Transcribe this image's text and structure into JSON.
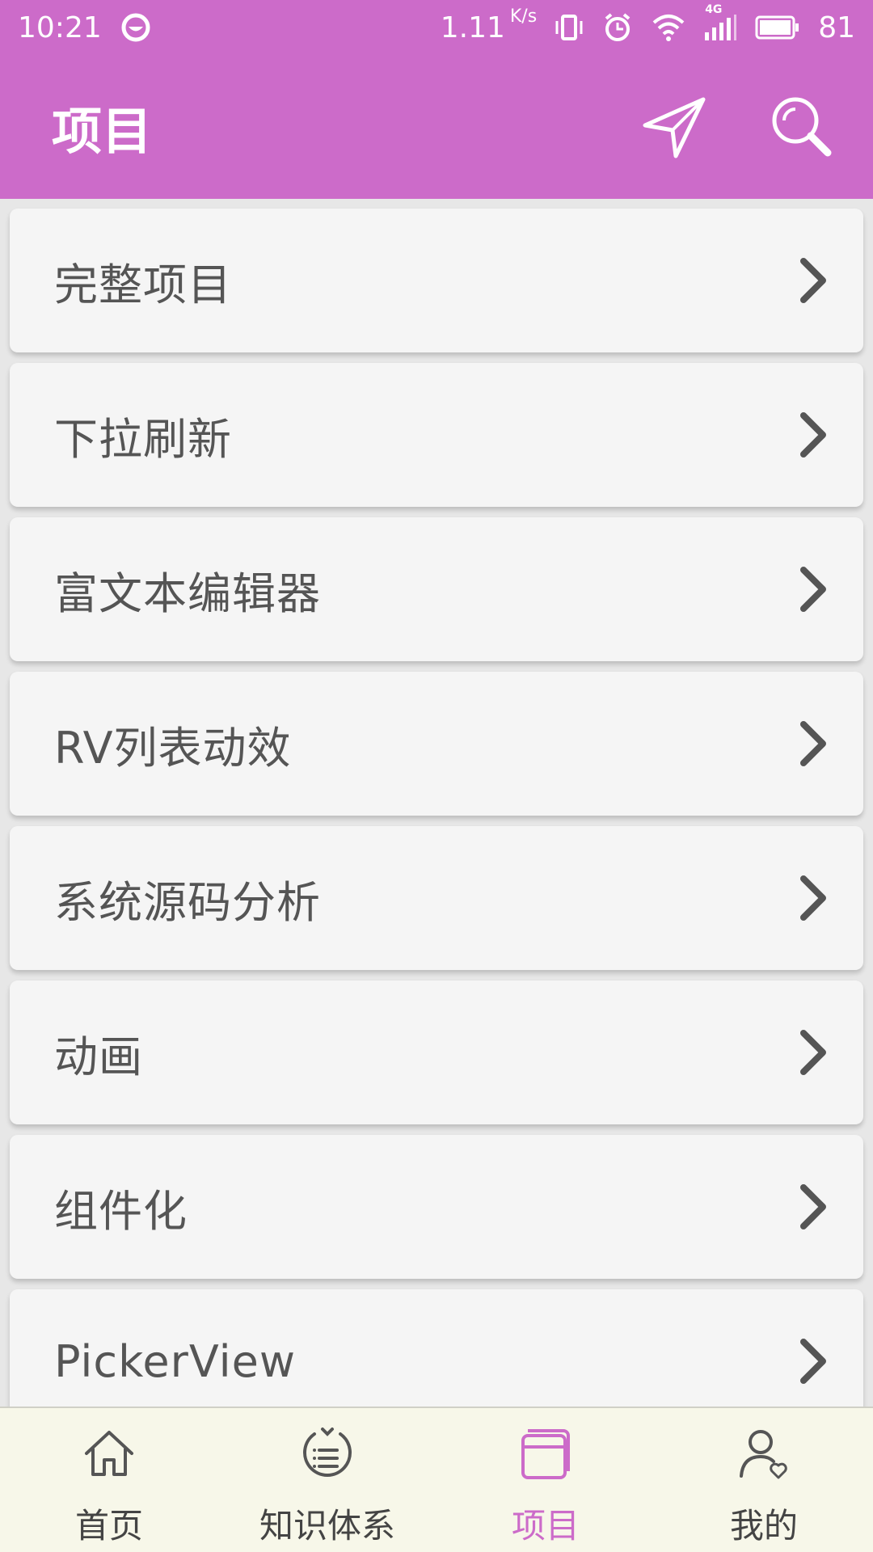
{
  "status_bar": {
    "time": "10:21",
    "network_speed": "1.11",
    "speed_unit": "K/s",
    "network_type": "4G",
    "battery": "81",
    "icons": [
      "assistant-icon",
      "vibrate-icon",
      "alarm-icon",
      "wifi-icon",
      "signal-icon",
      "battery-icon"
    ]
  },
  "toolbar": {
    "title": "项目",
    "icons": [
      "navigation-icon",
      "search-icon"
    ]
  },
  "list": {
    "items": [
      {
        "label": "完整项目"
      },
      {
        "label": "下拉刷新"
      },
      {
        "label": "富文本编辑器"
      },
      {
        "label": "RV列表动效"
      },
      {
        "label": "系统源码分析"
      },
      {
        "label": "动画"
      },
      {
        "label": "组件化"
      },
      {
        "label": "PickerView"
      }
    ]
  },
  "bottom_nav": {
    "items": [
      {
        "label": "首页",
        "icon": "home-icon"
      },
      {
        "label": "知识体系",
        "icon": "knowledge-icon"
      },
      {
        "label": "项目",
        "icon": "project-icon",
        "active": true
      },
      {
        "label": "我的",
        "icon": "profile-icon"
      }
    ]
  },
  "colors": {
    "accent": "#cc6bc9",
    "card_bg": "#f5f5f5",
    "page_bg": "#e7e7e7",
    "nav_bg": "#f7f7e9",
    "text": "#555555"
  }
}
